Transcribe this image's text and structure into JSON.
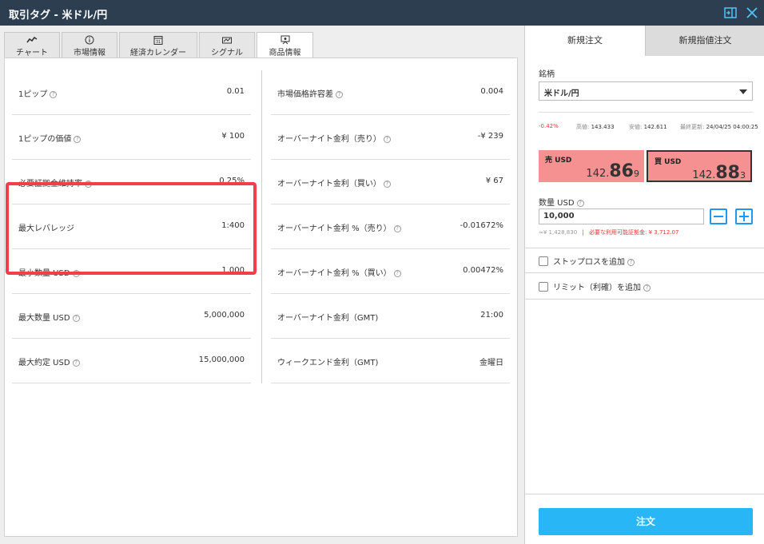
{
  "window": {
    "title": "取引タグ - 米ドル/円"
  },
  "tabs": [
    {
      "label": "チャート",
      "icon": "chart-line-icon"
    },
    {
      "label": "市場情報",
      "icon": "info-icon"
    },
    {
      "label": "経済カレンダー",
      "icon": "calendar-icon"
    },
    {
      "label": "シグナル",
      "icon": "signal-icon"
    },
    {
      "label": "商品情報",
      "icon": "product-info-icon"
    }
  ],
  "product_info": {
    "left": [
      {
        "label": "1ピップ",
        "value": "0.01"
      },
      {
        "label": "1ピップの価値",
        "value": "¥ 100"
      },
      {
        "label": "必要証拠金維持率",
        "value": "0.25%"
      },
      {
        "label": "最大レバレッジ",
        "value": "1:400"
      },
      {
        "label": "最小数量 USD",
        "value": "1,000"
      },
      {
        "label": "最大数量 USD",
        "value": "5,000,000"
      },
      {
        "label": "最大約定 USD",
        "value": "15,000,000"
      }
    ],
    "right": [
      {
        "label": "市場価格許容差",
        "value": "0.004"
      },
      {
        "label": "オーバーナイト金利（売り）",
        "value": "-¥ 239"
      },
      {
        "label": "オーバーナイト金利（買い）",
        "value": "¥ 67"
      },
      {
        "label": "オーバーナイト金利 %（売り）",
        "value": "-0.01672%"
      },
      {
        "label": "オーバーナイト金利 %（買い）",
        "value": "0.00472%"
      },
      {
        "label": "オーバーナイト金利（GMT)",
        "value": "21:00"
      },
      {
        "label": "ウィークエンド金利（GMT)",
        "value": "金曜日"
      }
    ]
  },
  "order_panel": {
    "tabs": [
      "新規注文",
      "新規指値注文"
    ],
    "symbol_label": "銘柄",
    "symbol_value": "米ドル/円",
    "stats": {
      "change": "-0.42%",
      "high_label": "高値:",
      "high": "143.433",
      "low_label": "安値:",
      "low": "142.611",
      "updated_label": "最終更新:",
      "updated": "24/04/25 04:00:25"
    },
    "sell": {
      "label": "売 USD",
      "price_prefix": "142.",
      "price_big": "86",
      "price_suffix": "9"
    },
    "buy": {
      "label": "買 USD",
      "price_prefix": "142.",
      "price_big": "88",
      "price_suffix": "3"
    },
    "quantity_label": "数量 USD",
    "quantity_value": "10,000",
    "margin_value": "≈¥ 1,428,830",
    "margin_sep": "|",
    "required_margin": "必要な利用可能証拠金: ¥ 3,712.07",
    "stop_loss_label": "ストップロスを追加",
    "limit_label": "リミット（利確）を追加",
    "order_button": "注文"
  },
  "colors": {
    "titlebar": "#2c3e50",
    "highlight": "#f03e4a",
    "price_box": "#f59190",
    "order_button": "#29b6f6",
    "stepper": "#2196f3"
  }
}
